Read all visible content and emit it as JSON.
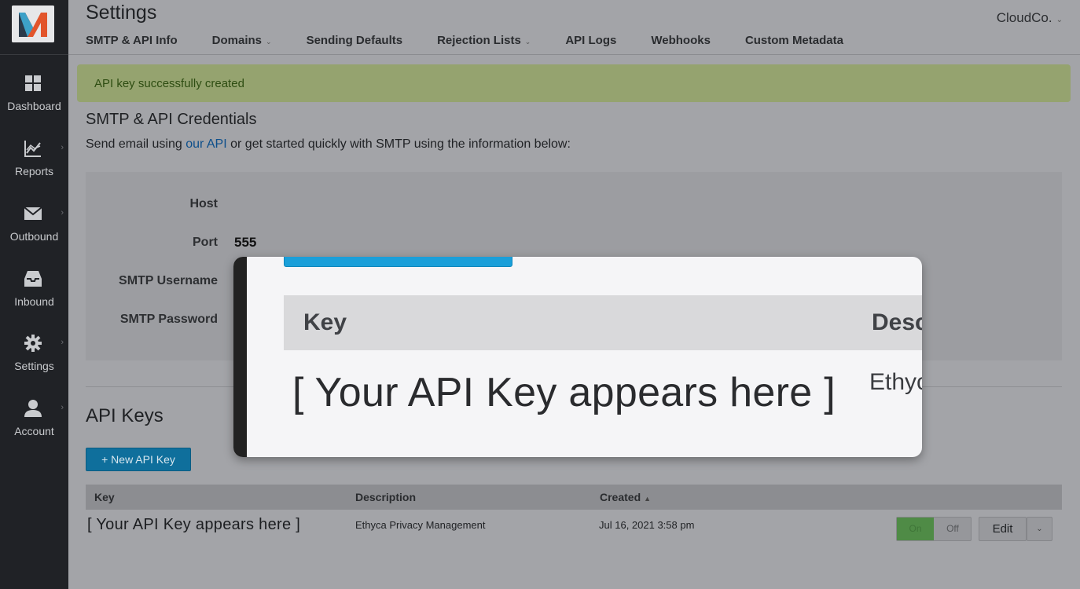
{
  "app": {
    "name": "Mandrill",
    "account_name": "CloudCo."
  },
  "sidebar": {
    "items": [
      {
        "label": "Dashboard",
        "icon": "dashboard-icon"
      },
      {
        "label": "Reports",
        "icon": "reports-icon"
      },
      {
        "label": "Outbound",
        "icon": "outbound-mail-icon"
      },
      {
        "label": "Inbound",
        "icon": "inbound-tray-icon"
      },
      {
        "label": "Settings",
        "icon": "gear-icon"
      },
      {
        "label": "Account",
        "icon": "user-icon"
      }
    ]
  },
  "header": {
    "title": "Settings",
    "tabs": [
      {
        "label": "SMTP & API Info"
      },
      {
        "label": "Domains"
      },
      {
        "label": "Sending Defaults"
      },
      {
        "label": "Rejection Lists"
      },
      {
        "label": "API Logs"
      },
      {
        "label": "Webhooks"
      },
      {
        "label": "Custom Metadata"
      }
    ]
  },
  "alert": {
    "message": "API key successfully created"
  },
  "credentials": {
    "title": "SMTP & API Credentials",
    "desc_before": "Send email using ",
    "desc_link": "our API",
    "desc_after": " or get started quickly with SMTP using the information below:",
    "fields": [
      {
        "label": "Host",
        "value": ""
      },
      {
        "label": "Port",
        "value": "555"
      },
      {
        "label": "SMTP Username",
        "value": ""
      },
      {
        "label": "SMTP Password",
        "value": ""
      }
    ]
  },
  "api_keys": {
    "title": "API Keys",
    "new_button": "+ New API Key",
    "columns": {
      "key": "Key",
      "description": "Description",
      "created": "Created"
    },
    "rows": [
      {
        "key": "[ Your API Key appears here ]",
        "description": "Ethyca Privacy Management",
        "created": "Jul 16, 2021 3:58 pm",
        "toggle_on": "On",
        "toggle_off": "Off",
        "edit": "Edit"
      }
    ]
  },
  "zoom_callout": {
    "header_key": "Key",
    "header_desc": "Desc",
    "key_text": "[ Your API Key appears here ]",
    "desc_text": "Ethyc"
  },
  "colors": {
    "accent_blue": "#1a9fd9",
    "alert_green": "#95a36f",
    "sidebar_bg": "#202226"
  }
}
